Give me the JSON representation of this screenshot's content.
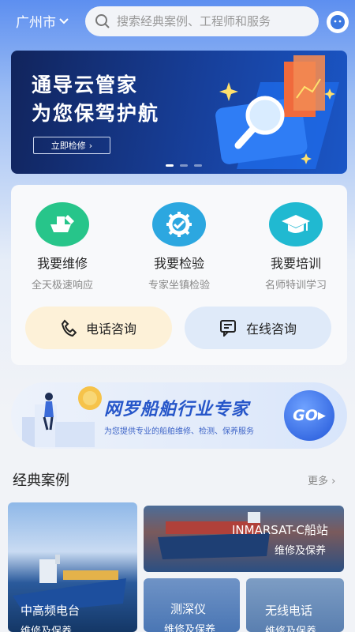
{
  "header": {
    "city": "广州市",
    "search_placeholder": "搜索经典案例、工程师和服务"
  },
  "banner": {
    "line1": "通导云管家",
    "line2": "为您保驾护航",
    "button": "立即检修"
  },
  "services": [
    {
      "title": "我要维修",
      "subtitle": "全天极速响应",
      "color": "#27c58a"
    },
    {
      "title": "我要检验",
      "subtitle": "专家坐镇检验",
      "color": "#2ca7e0"
    },
    {
      "title": "我要培训",
      "subtitle": "名师特训学习",
      "color": "#20b9d1"
    }
  ],
  "consult": {
    "phone": "电话咨询",
    "online": "在线咨询"
  },
  "promo": {
    "title": "网罗船舶行业专家",
    "subtitle": "为您提供专业的船舶维修、检测、保养服务",
    "go": "GO"
  },
  "cases_section": {
    "title": "经典案例",
    "more": "更多"
  },
  "cases": [
    {
      "title": "中高频电台",
      "subtitle": "维修及保养"
    },
    {
      "title": "INMARSAT-C船站",
      "subtitle": "维修及保养"
    },
    {
      "title": "测深仪",
      "subtitle": "维修及保养"
    },
    {
      "title": "无线电话",
      "subtitle": "维修及保养"
    }
  ]
}
